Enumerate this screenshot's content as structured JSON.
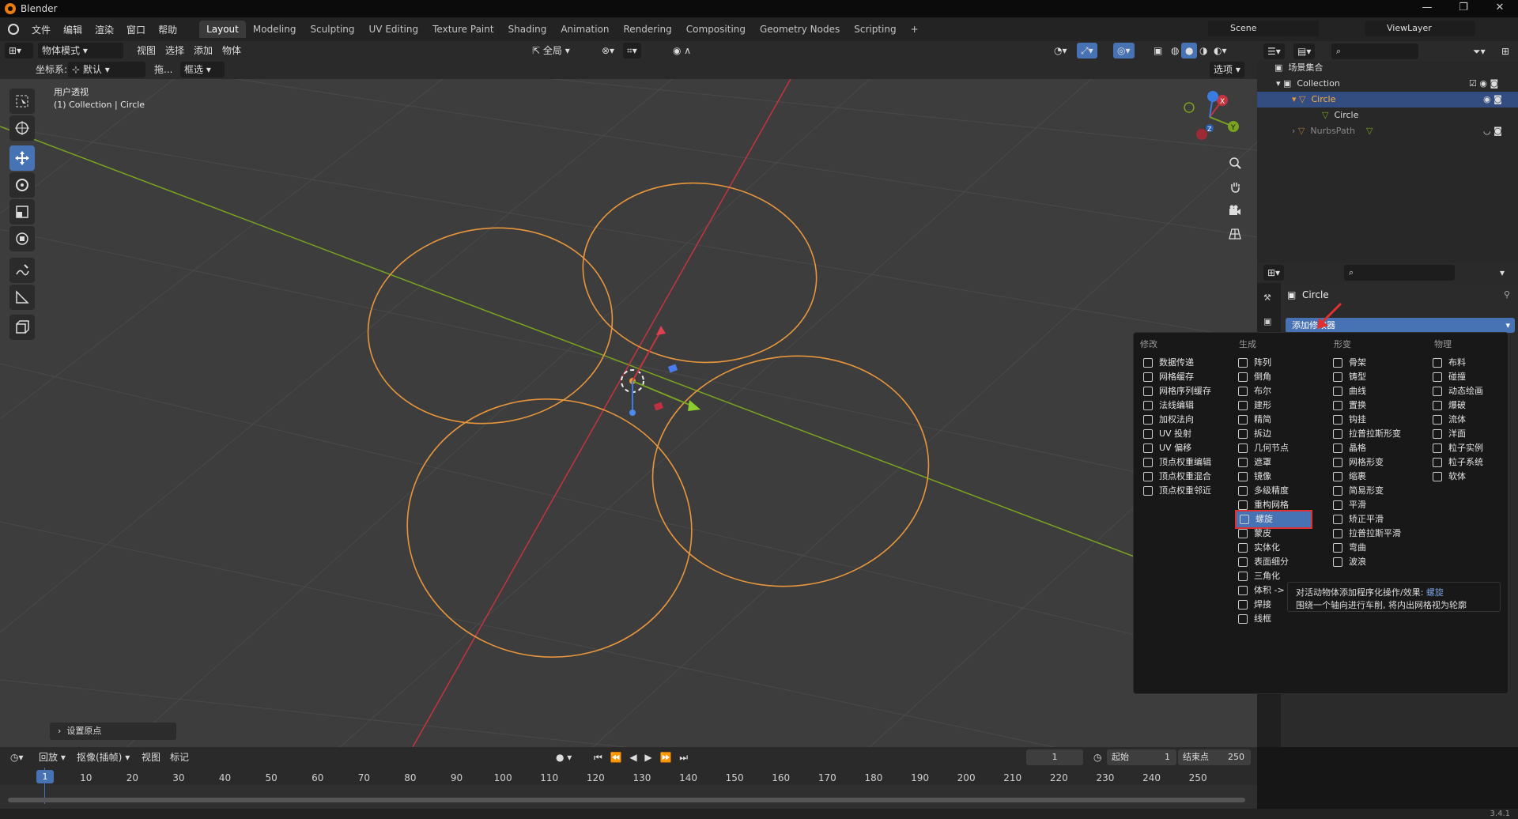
{
  "title": "Blender",
  "menus": [
    "文件",
    "编辑",
    "渲染",
    "窗口",
    "帮助"
  ],
  "workspaces": [
    "Layout",
    "Modeling",
    "Sculpting",
    "UV Editing",
    "Texture Paint",
    "Shading",
    "Animation",
    "Rendering",
    "Compositing",
    "Geometry Nodes",
    "Scripting"
  ],
  "active_workspace": "Layout",
  "scene": "Scene",
  "view_layer": "ViewLayer",
  "viewport_header": {
    "mode": "物体模式",
    "view": "视图",
    "select": "选择",
    "add": "添加",
    "object": "物体",
    "transform": "全局",
    "coord_label": "坐标系:",
    "coord_value": "默认",
    "drag_label": "拖...",
    "drag_value": "框选",
    "options": "选项"
  },
  "viewport": {
    "view_name": "用户透视",
    "collection_info": "(1) Collection | Circle",
    "last_op": "设置原点"
  },
  "outliner": {
    "scene_collection": "场景集合",
    "collection": "Collection",
    "circle": "Circle",
    "circle_data": "Circle",
    "nurbs": "NurbsPath"
  },
  "properties": {
    "object_name": "Circle",
    "add_modifier": "添加修改器"
  },
  "modifier_menu": {
    "headers": [
      "修改",
      "生成",
      "形变",
      "物理"
    ],
    "modify": [
      "数据传递",
      "网格缓存",
      "网格序列缓存",
      "法线编辑",
      "加权法向",
      "UV 投射",
      "UV 偏移",
      "顶点权重编辑",
      "顶点权重混合",
      "顶点权重邻近"
    ],
    "generate": [
      "阵列",
      "倒角",
      "布尔",
      "建形",
      "精简",
      "拆边",
      "几何节点",
      "遮罩",
      "镜像",
      "多级精度",
      "重构网格",
      "螺旋",
      "蒙皮",
      "实体化",
      "表面细分",
      "三角化",
      "体积 -> 网格",
      "焊接",
      "线框"
    ],
    "deform": [
      "骨架",
      "铸型",
      "曲线",
      "置换",
      "钩挂",
      "拉普拉斯形变",
      "晶格",
      "网格形变",
      "缩裹",
      "简易形变",
      "平滑",
      "矫正平滑",
      "拉普拉斯平滑",
      "弯曲",
      "波浪"
    ],
    "physics": [
      "布料",
      "碰撞",
      "动态绘画",
      "爆破",
      "流体",
      "洋面",
      "粒子实例",
      "粒子系统",
      "软体"
    ],
    "highlighted": "螺旋"
  },
  "tooltip": {
    "line1_prefix": "对活动物体添加程序化操作/效果: ",
    "line1_name": "螺旋",
    "line2": "围绕一个轴向进行车削, 将内出网格视为轮廓"
  },
  "timeline": {
    "playback": "回放",
    "keying": "抠像(插帧)",
    "view": "视图",
    "marker": "标记",
    "current_frame": "1",
    "start_label": "起始",
    "start": "1",
    "end_label": "结束点",
    "end": "250",
    "ticks": [
      "1",
      "10",
      "20",
      "30",
      "40",
      "50",
      "60",
      "70",
      "80",
      "90",
      "100",
      "110",
      "120",
      "130",
      "140",
      "150",
      "160",
      "170",
      "180",
      "190",
      "200",
      "210",
      "220",
      "230",
      "240",
      "250"
    ]
  },
  "version": "3.4.1",
  "colors": {
    "accent": "#4772b3",
    "selection": "#e8963c",
    "x_axis": "#c4343f",
    "y_axis": "#7aa320",
    "highlight_box": "#e03030"
  }
}
